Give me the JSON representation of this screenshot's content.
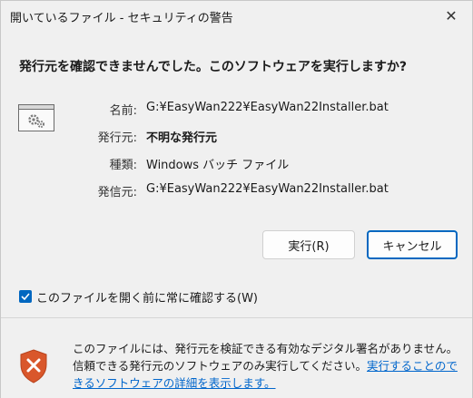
{
  "window": {
    "title": "開いているファイル - セキュリティの警告",
    "close_glyph": "✕"
  },
  "question": "発行元を確認できませんでした。このソフトウェアを実行しますか?",
  "details": {
    "name_label": "名前:",
    "name_value": "G:¥EasyWan222¥EasyWan22Installer.bat",
    "publisher_label": "発行元:",
    "publisher_value": "不明な発行元",
    "type_label": "種類:",
    "type_value": "Windows バッチ ファイル",
    "from_label": "発信元:",
    "from_value": "G:¥EasyWan222¥EasyWan22Installer.bat"
  },
  "buttons": {
    "run": "実行(R)",
    "cancel": "キャンセル"
  },
  "checkbox": {
    "label": "このファイルを開く前に常に確認する(W)",
    "checked": true
  },
  "warning": {
    "text": "このファイルには、発行元を検証できる有効なデジタル署名がありません。信頼できる発行元のソフトウェアのみ実行してください。",
    "link": "実行することのできるソフトウェアの詳細を表示します。"
  },
  "icons": {
    "file": "file-gear-icon",
    "shield": "shield-warning-icon",
    "check": "checkmark-icon"
  },
  "colors": {
    "accent": "#0067c0",
    "link": "#0066cc",
    "shield": "#d9572b"
  }
}
